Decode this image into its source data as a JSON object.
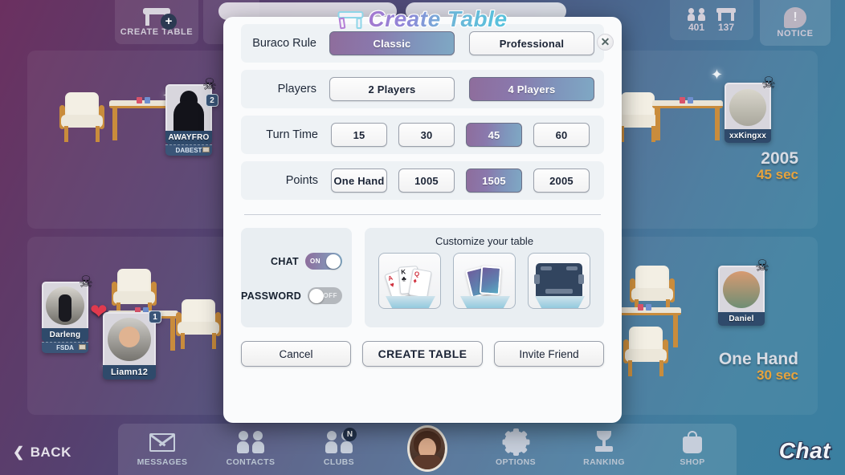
{
  "topbar": {
    "create_table_label": "CREATE TABLE",
    "create_table_icon": "table-plus-icon",
    "share_icon": "share-icon",
    "players_online": "401",
    "tables_open": "137",
    "notice_label": "NOTICE",
    "notice_icon": "notice-bubble-icon"
  },
  "lobby": {
    "tables": [
      {
        "player": "AWAYFRO",
        "club": "DABEST",
        "seat_badge": "2",
        "skull_icon": "skull-icon"
      },
      {
        "player": "xxKingxx",
        "points": "2005",
        "time": "45 sec",
        "skull_icon": "skull-icon"
      },
      {
        "player": "Darleng",
        "club": "FSDA",
        "skull_icon": "skull-icon"
      },
      {
        "player": "Liamn12",
        "seat_badge": "1",
        "heart_icon": "heart-icon"
      },
      {
        "player": "Daniel",
        "points": "One Hand",
        "time": "30 sec",
        "skull_icon": "skull-icon"
      }
    ]
  },
  "bottom_nav": {
    "back_label": "BACK",
    "back_icon": "chevron-left-icon",
    "items": [
      {
        "label": "MESSAGES",
        "icon": "envelope-icon"
      },
      {
        "label": "CONTACTS",
        "icon": "people-icon"
      },
      {
        "label": "CLUBS",
        "icon": "people-icon",
        "badge": "N"
      },
      {
        "label": "",
        "icon": "avatar-icon"
      },
      {
        "label": "OPTIONS",
        "icon": "gear-icon"
      },
      {
        "label": "RANKING",
        "icon": "trophy-icon"
      },
      {
        "label": "SHOP",
        "icon": "shopping-bag-icon"
      }
    ],
    "chat_label": "Chat"
  },
  "modal": {
    "title": "Create Table",
    "title_icon": "table-icon",
    "close_icon": "close-icon",
    "rows": [
      {
        "label": "Buraco Rule",
        "options": [
          {
            "text": "Classic",
            "selected": true
          },
          {
            "text": "Professional",
            "selected": false
          }
        ]
      },
      {
        "label": "Players",
        "options": [
          {
            "text": "2 Players",
            "selected": false
          },
          {
            "text": "4 Players",
            "selected": true
          }
        ]
      },
      {
        "label": "Turn Time",
        "options": [
          {
            "text": "15",
            "selected": false
          },
          {
            "text": "30",
            "selected": false
          },
          {
            "text": "45",
            "selected": true
          },
          {
            "text": "60",
            "selected": false
          }
        ]
      },
      {
        "label": "Points",
        "options": [
          {
            "text": "One Hand",
            "selected": false
          },
          {
            "text": "1005",
            "selected": false
          },
          {
            "text": "1505",
            "selected": true
          },
          {
            "text": "2005",
            "selected": false
          }
        ]
      }
    ],
    "toggles": [
      {
        "label": "CHAT",
        "state": "ON",
        "on": true
      },
      {
        "label": "PASSWORD",
        "state": "OFF",
        "on": false
      }
    ],
    "customize": {
      "title": "Customize your table",
      "items": [
        {
          "name": "card-faces-preview",
          "cards": [
            {
              "rank": "A",
              "suit": "♥",
              "color": "red"
            },
            {
              "rank": "K",
              "suit": "♣",
              "color": "blk"
            },
            {
              "rank": "Q",
              "suit": "♦",
              "color": "red"
            }
          ]
        },
        {
          "name": "card-backs-preview"
        },
        {
          "name": "table-design-preview"
        }
      ]
    },
    "footer": {
      "cancel": "Cancel",
      "create": "CREATE TABLE",
      "invite": "Invite Friend"
    }
  },
  "colors": {
    "accent_purple": "#8e6d9c",
    "accent_blue": "#7fa8c4",
    "modal_bg": "#fafbfc",
    "row_bg": "#eef2f5",
    "time_orange": "#e8a33c"
  }
}
